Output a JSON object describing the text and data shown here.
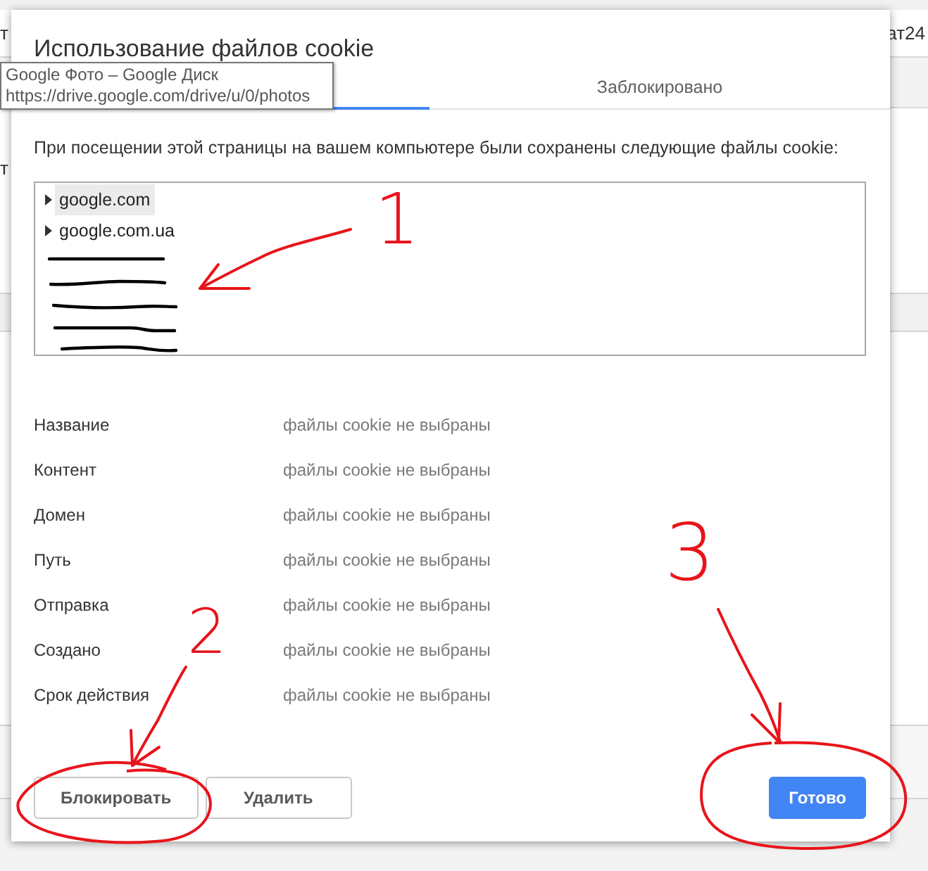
{
  "background_page": {
    "left_edge_texts": [
      "т",
      "т"
    ],
    "right_edge_texts": [
      "ат24"
    ]
  },
  "dialog": {
    "title": "Использование файлов cookie",
    "tabs": [
      {
        "selected": true
      },
      {
        "label": "Заблокировано",
        "selected": false
      }
    ],
    "description": "При посещении этой страницы на вашем компьютере были сохранены следующие файлы cookie:",
    "cookie_tree": [
      {
        "kind": "domain",
        "label": "google.com",
        "expanded": false,
        "selected": true
      },
      {
        "kind": "domain",
        "label": "google.com.ua",
        "expanded": false,
        "selected": false
      },
      {
        "kind": "redacted"
      },
      {
        "kind": "redacted"
      },
      {
        "kind": "redacted"
      },
      {
        "kind": "redacted"
      },
      {
        "kind": "redacted"
      }
    ],
    "details": [
      {
        "label": "Название",
        "value": "файлы cookie не выбраны"
      },
      {
        "label": "Контент",
        "value": "файлы cookie не выбраны"
      },
      {
        "label": "Домен",
        "value": "файлы cookie не выбраны"
      },
      {
        "label": "Путь",
        "value": "файлы cookie не выбраны"
      },
      {
        "label": "Отправка",
        "value": "файлы cookie не выбраны"
      },
      {
        "label": "Создано",
        "value": "файлы cookie не выбраны"
      },
      {
        "label": "Срок действия",
        "value": "файлы cookie не выбраны"
      }
    ],
    "buttons": [
      {
        "label": "Блокировать",
        "kind": "secondary"
      },
      {
        "label": "Удалить",
        "kind": "secondary"
      },
      {
        "label": "Готово",
        "kind": "primary"
      }
    ]
  },
  "tooltip": {
    "title": "Google Фото – Google Диск",
    "url": "https://drive.google.com/drive/u/0/photos"
  },
  "annotations": [
    {
      "label": "1",
      "circled": false
    },
    {
      "label": "2",
      "circled": true
    },
    {
      "label": "3",
      "circled": true
    }
  ]
}
